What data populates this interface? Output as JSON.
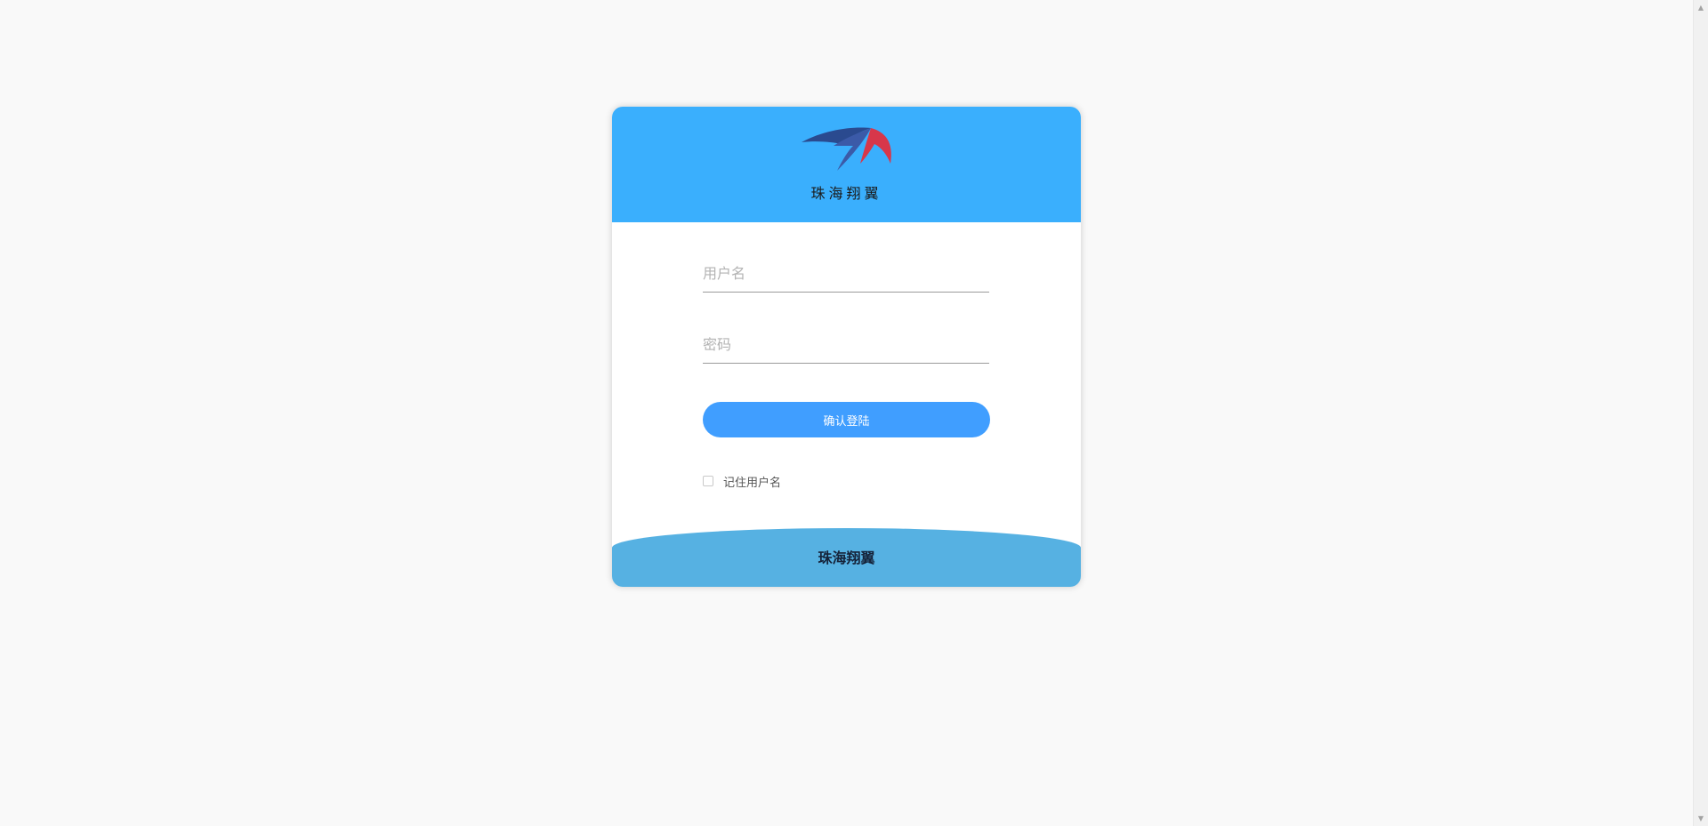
{
  "brand": {
    "logo_text": "珠海翔翼",
    "footer_text": "珠海翔翼",
    "header_color": "#3aaffd",
    "footer_color": "#56b1e2",
    "accent": "#409eff"
  },
  "form": {
    "username_placeholder": "用户名",
    "password_placeholder": "密码",
    "login_label": "确认登陆",
    "remember_label": "记住用户名",
    "remember_checked": false
  }
}
